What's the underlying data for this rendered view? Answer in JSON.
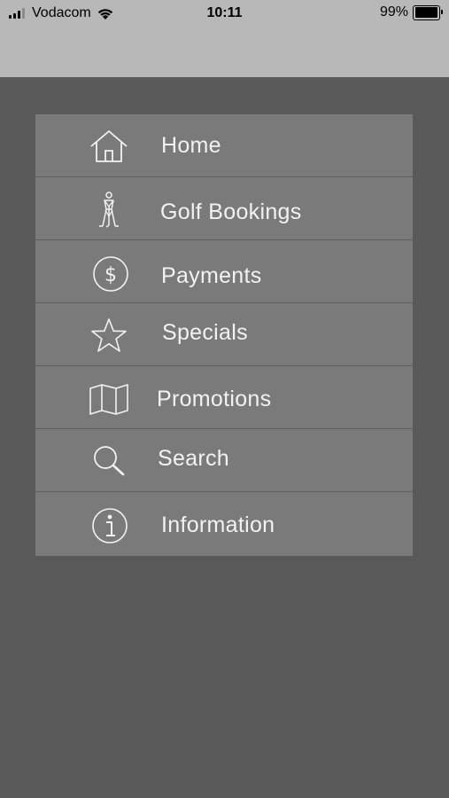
{
  "status_bar": {
    "carrier": "Vodacom",
    "time": "10:11",
    "battery_percent": "99%",
    "battery_level": 0.99
  },
  "menu": {
    "items": [
      {
        "label": "Home",
        "icon": "home-icon"
      },
      {
        "label": "Golf Bookings",
        "icon": "golfer-icon"
      },
      {
        "label": "Payments",
        "icon": "dollar-circle-icon"
      },
      {
        "label": "Specials",
        "icon": "star-icon"
      },
      {
        "label": "Promotions",
        "icon": "map-icon"
      },
      {
        "label": "Search",
        "icon": "search-icon"
      },
      {
        "label": "Information",
        "icon": "info-icon"
      }
    ]
  },
  "colors": {
    "background": "#595959",
    "top_bar": "#b8b8b8",
    "menu_item": "#7a7a7a",
    "divider": "#5f5f5f",
    "text": "#f2f2f2"
  }
}
